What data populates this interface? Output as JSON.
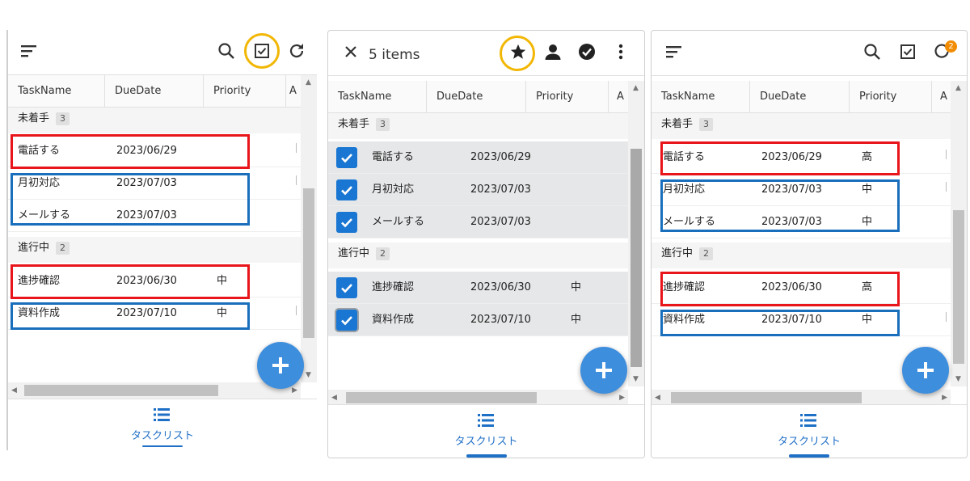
{
  "columns": [
    "TaskName",
    "DueDate",
    "Priority",
    "A"
  ],
  "groups": [
    {
      "label": "未着手",
      "count": "3"
    },
    {
      "label": "進行中",
      "count": "2"
    }
  ],
  "panel1": {
    "rows": [
      {
        "name": "電話する",
        "due": "2023/06/29",
        "priority": ""
      },
      {
        "name": "月初対応",
        "due": "2023/07/03",
        "priority": ""
      },
      {
        "name": "メールする",
        "due": "2023/07/03",
        "priority": ""
      },
      {
        "name": "進捗確認",
        "due": "2023/06/30",
        "priority": "中"
      },
      {
        "name": "資料作成",
        "due": "2023/07/10",
        "priority": "中"
      }
    ]
  },
  "panel2": {
    "selection_title": "5 items",
    "rows": [
      {
        "name": "電話する",
        "due": "2023/06/29",
        "priority": ""
      },
      {
        "name": "月初対応",
        "due": "2023/07/03",
        "priority": ""
      },
      {
        "name": "メールする",
        "due": "2023/07/03",
        "priority": ""
      },
      {
        "name": "進捗確認",
        "due": "2023/06/30",
        "priority": "中"
      },
      {
        "name": "資料作成",
        "due": "2023/07/10",
        "priority": "中"
      }
    ]
  },
  "panel3": {
    "refresh_badge": "2",
    "rows": [
      {
        "name": "電話する",
        "due": "2023/06/29",
        "priority": "高"
      },
      {
        "name": "月初対応",
        "due": "2023/07/03",
        "priority": "中"
      },
      {
        "name": "メールする",
        "due": "2023/07/03",
        "priority": "中"
      },
      {
        "name": "進捗確認",
        "due": "2023/06/30",
        "priority": "高"
      },
      {
        "name": "資料作成",
        "due": "2023/07/10",
        "priority": "中"
      }
    ]
  },
  "nav": {
    "label": "タスクリスト"
  },
  "icons": {
    "menu": "sort-menu-icon",
    "search": "search-icon",
    "checkbox": "select-checkbox-icon",
    "refresh": "refresh-icon",
    "close": "close-icon",
    "star": "star-icon",
    "person": "person-icon",
    "check_circle": "check-circle-icon",
    "more": "more-vert-icon",
    "add": "add-icon",
    "list": "list-icon"
  },
  "colors": {
    "accent": "#1976d2",
    "fab": "#3e8ede",
    "highlight_ring": "#f2b705",
    "annotation_red": "#e8151b",
    "annotation_blue": "#1a6fbd",
    "badge": "#f28c00"
  }
}
